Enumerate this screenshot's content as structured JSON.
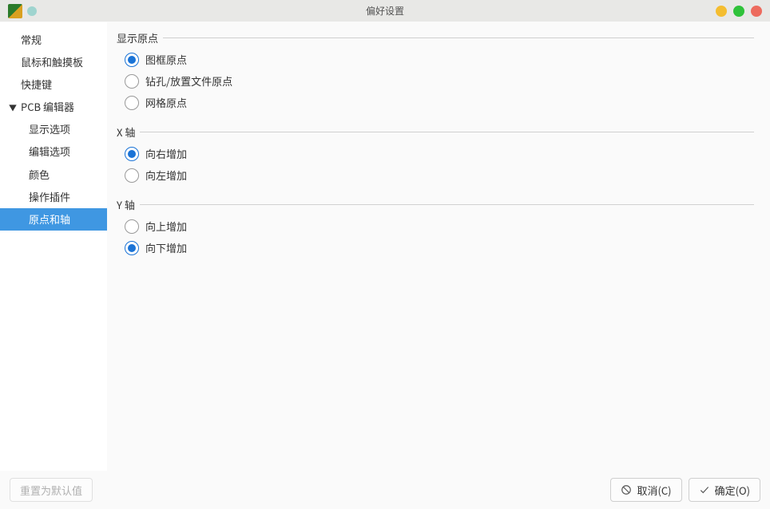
{
  "window": {
    "title": "偏好设置"
  },
  "sidebar": {
    "items": [
      {
        "label": "常规",
        "expandable": false
      },
      {
        "label": "鼠标和触摸板",
        "expandable": false
      },
      {
        "label": "快捷键",
        "expandable": false
      },
      {
        "label": "PCB 编辑器",
        "expandable": true,
        "expanded": true,
        "children": [
          {
            "label": "显示选项"
          },
          {
            "label": "编辑选项"
          },
          {
            "label": "颜色"
          },
          {
            "label": "操作插件"
          },
          {
            "label": "原点和轴",
            "selected": true
          }
        ]
      }
    ]
  },
  "groups": {
    "display_origin": {
      "legend": "显示原点",
      "options": [
        {
          "label": "图框原点",
          "checked": true
        },
        {
          "label": "钻孔/放置文件原点",
          "checked": false
        },
        {
          "label": "网格原点",
          "checked": false
        }
      ]
    },
    "x_axis": {
      "legend": "X 轴",
      "options": [
        {
          "label": "向右增加",
          "checked": true
        },
        {
          "label": "向左增加",
          "checked": false
        }
      ]
    },
    "y_axis": {
      "legend": "Y 轴",
      "options": [
        {
          "label": "向上增加",
          "checked": false
        },
        {
          "label": "向下增加",
          "checked": true
        }
      ]
    }
  },
  "footer": {
    "reset_label": "重置为默认值",
    "cancel_label": "取消(C)",
    "ok_label": "确定(O)"
  }
}
